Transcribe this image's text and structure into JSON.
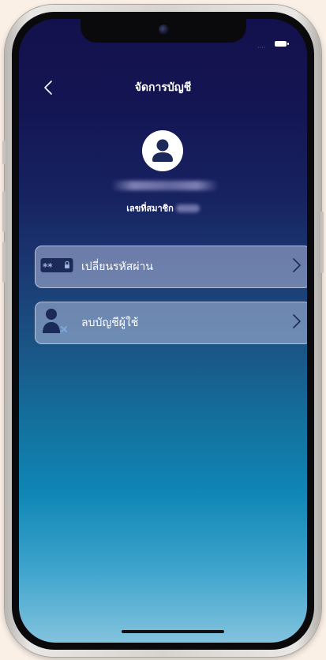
{
  "header": {
    "title": "จัดการบัญชี",
    "back_icon": "chevron-left-icon"
  },
  "profile": {
    "avatar_icon": "user-avatar-icon",
    "member_label": "เลขที่สมาชิก"
  },
  "menu": [
    {
      "label": "เปลี่ยนรหัสผ่าน",
      "icon": "password-key-icon",
      "password_mask": "**"
    },
    {
      "label": "ลบบัญชีผู้ใช้",
      "icon": "delete-user-icon"
    }
  ],
  "colors": {
    "background_top": "#13114d",
    "background_bottom": "#83c3de",
    "icon_dark": "#1c2a5a",
    "text": "#ffffff"
  }
}
